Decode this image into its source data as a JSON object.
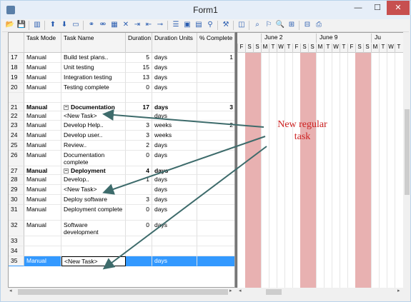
{
  "window": {
    "title": "Form1"
  },
  "title_buttons": {
    "minimize": "—",
    "maximize": "☐",
    "close": "✕"
  },
  "toolbar": {
    "icons": [
      {
        "name": "open-icon",
        "glyph": "📂"
      },
      {
        "name": "save-icon",
        "glyph": "💾"
      },
      {
        "name": "columns-icon",
        "glyph": "▥"
      },
      {
        "name": "move-up-icon",
        "glyph": "⬆"
      },
      {
        "name": "move-down-icon",
        "glyph": "⬇"
      },
      {
        "name": "window-icon",
        "glyph": "▭"
      },
      {
        "name": "link-icon",
        "glyph": "⚭"
      },
      {
        "name": "unlink-icon",
        "glyph": "⚮"
      },
      {
        "name": "calendar-icon",
        "glyph": "▦"
      },
      {
        "name": "delete-icon",
        "glyph": "✕"
      },
      {
        "name": "indent-icon",
        "glyph": "⇥"
      },
      {
        "name": "outdent-icon",
        "glyph": "⇤"
      },
      {
        "name": "milestone-icon",
        "glyph": "⊸"
      },
      {
        "name": "filter-icon",
        "glyph": "☰"
      },
      {
        "name": "task-info-icon",
        "glyph": "▣"
      },
      {
        "name": "notes-icon",
        "glyph": "▤"
      },
      {
        "name": "resources-icon",
        "glyph": "⚲"
      },
      {
        "name": "hammer-icon",
        "glyph": "⚒"
      },
      {
        "name": "critical-path-icon",
        "glyph": "◫"
      },
      {
        "name": "zoom-icon",
        "glyph": "⌕"
      },
      {
        "name": "pan-icon",
        "glyph": "⚐"
      },
      {
        "name": "search-icon",
        "glyph": "🔍"
      },
      {
        "name": "zoom-in-icon",
        "glyph": "⊞"
      },
      {
        "name": "zoom-out-icon",
        "glyph": "⊟"
      },
      {
        "name": "print-icon",
        "glyph": "⎙"
      }
    ]
  },
  "columns": {
    "task_mode": "Task Mode",
    "task_name": "Task Name",
    "duration": "Duration",
    "duration_units": "Duration Units",
    "percent_complete": "% Complete"
  },
  "rows": [
    {
      "num": "17",
      "mode": "Manual",
      "name": "Build test plans..",
      "dur": "5",
      "units": "days",
      "pct": "1",
      "h": 14
    },
    {
      "num": "18",
      "mode": "Manual",
      "name": "Unit testing",
      "dur": "15",
      "units": "days",
      "pct": "",
      "h": 14
    },
    {
      "num": "19",
      "mode": "Manual",
      "name": "Integration testing",
      "dur": "13",
      "units": "days",
      "pct": "",
      "h": 14
    },
    {
      "num": "20",
      "mode": "Manual",
      "name": "Testing complete",
      "dur": "0",
      "units": "days",
      "pct": "",
      "h": 14
    },
    {
      "num": "",
      "mode": "",
      "name": "",
      "dur": "",
      "units": "",
      "pct": "",
      "h": 14
    },
    {
      "num": "21",
      "mode": "Manual",
      "name": "Documentation",
      "dur": "17",
      "units": "days",
      "pct": "3",
      "h": 12,
      "summary": true,
      "toggle": "−"
    },
    {
      "num": "22",
      "mode": "Manual",
      "name": "<New Task>",
      "dur": "",
      "units": "days",
      "pct": "",
      "h": 13
    },
    {
      "num": "23",
      "mode": "Manual",
      "name": "Develop Help..",
      "dur": "3",
      "units": "weeks",
      "pct": "2",
      "h": 14
    },
    {
      "num": "24",
      "mode": "Manual",
      "name": "Develop user..",
      "dur": "3",
      "units": "weeks",
      "pct": "",
      "h": 14
    },
    {
      "num": "25",
      "mode": "Manual",
      "name": "Review..",
      "dur": "2",
      "units": "days",
      "pct": "",
      "h": 14
    },
    {
      "num": "26",
      "mode": "Manual",
      "name": "Documentation complete",
      "dur": "0",
      "units": "days",
      "pct": "",
      "h": 22,
      "wrap": true
    },
    {
      "num": "27",
      "mode": "Manual",
      "name": "Deployment",
      "dur": "4",
      "units": "days",
      "pct": "",
      "h": 12,
      "summary": true,
      "toggle": "−"
    },
    {
      "num": "28",
      "mode": "Manual",
      "name": "Develop..",
      "dur": "1",
      "units": "days",
      "pct": "",
      "h": 14
    },
    {
      "num": "29",
      "mode": "Manual",
      "name": "<New Task>",
      "dur": "",
      "units": "days",
      "pct": "",
      "h": 14
    },
    {
      "num": "30",
      "mode": "Manual",
      "name": "Deploy software",
      "dur": "3",
      "units": "days",
      "pct": "",
      "h": 14
    },
    {
      "num": "31",
      "mode": "Manual",
      "name": "Deployment complete",
      "dur": "0",
      "units": "days",
      "pct": "",
      "h": 22,
      "wrap": true
    },
    {
      "num": "32",
      "mode": "Manual",
      "name": "Software development complete",
      "dur": "0",
      "units": "days",
      "pct": "",
      "h": 22,
      "wrap": true
    },
    {
      "num": "33",
      "mode": "",
      "name": "",
      "dur": "",
      "units": "",
      "pct": "",
      "h": 14
    },
    {
      "num": "34",
      "mode": "",
      "name": "",
      "dur": "",
      "units": "",
      "pct": "",
      "h": 14
    },
    {
      "num": "35",
      "mode": "Manual",
      "name": "<New Task>",
      "dur": "",
      "units": "days",
      "pct": "",
      "h": 14,
      "selected": true
    }
  ],
  "gantt": {
    "weeks": [
      "June 2",
      "June 9",
      "Ju"
    ],
    "days": [
      "F",
      "S",
      "S",
      "M",
      "T",
      "W",
      "T",
      "F",
      "S",
      "S",
      "M",
      "T",
      "W",
      "T",
      "F",
      "S",
      "S",
      "M",
      "T",
      "W",
      "T"
    ]
  },
  "annotation": {
    "text": "New regular task",
    "color": "#cc1f1f"
  },
  "scroll_arrows": {
    "left": "◂",
    "right": "▸"
  }
}
